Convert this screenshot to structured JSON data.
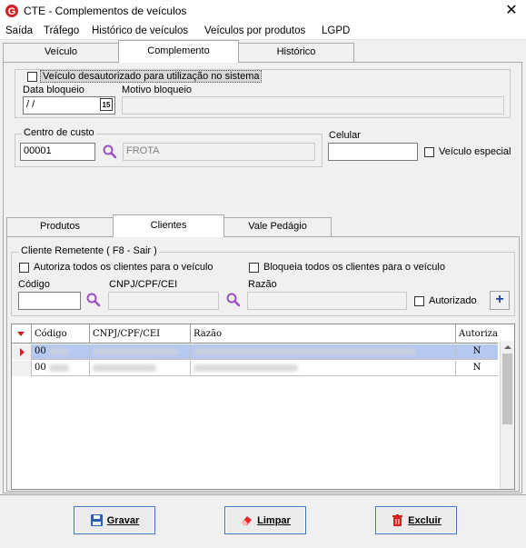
{
  "window": {
    "title": "CTE - Complementos de veículos",
    "close_glyph": "✕",
    "logo_letter": "G"
  },
  "menu": [
    "Saída",
    "Tráfego",
    "Histórico de veículos",
    "Veículos por produtos",
    "LGPD"
  ],
  "main_tabs": [
    {
      "label": "Veículo",
      "active": false
    },
    {
      "label": "Complemento",
      "active": true
    },
    {
      "label": "Histórico",
      "active": false
    }
  ],
  "vehicle_block": {
    "checkbox_label": "Veículo desautorizado para utilização no sistema",
    "checked": false,
    "data_bloqueio_label": "Data bloqueio",
    "data_bloqueio_value": " /  /",
    "calendar_glyph": "15",
    "motivo_label": "Motivo bloqueio",
    "motivo_value": ""
  },
  "centro_custo": {
    "group_label": "Centro de custo",
    "code_value": "00001",
    "name_value": "FROTA"
  },
  "celular": {
    "label": "Celular",
    "value": ""
  },
  "veiculo_especial": {
    "label": "Veículo especial",
    "checked": false
  },
  "sub_tabs": [
    {
      "label": "Produtos",
      "active": false
    },
    {
      "label": "Clientes",
      "active": true
    },
    {
      "label": "Vale Pedágio",
      "active": false
    }
  ],
  "cliente_remetente": {
    "group_label": "Cliente Remetente ( F8 - Sair )",
    "autoriza_todos": "Autoriza todos os clientes para o veículo",
    "bloqueia_todos": "Bloqueia todos os clientes para o veículo",
    "codigo_label": "Código",
    "cnpj_label": "CNPJ/CPF/CEI",
    "razao_label": "Razão",
    "autorizado_label": "Autorizado",
    "add_glyph": "+"
  },
  "grid": {
    "columns": [
      "Código",
      "CNPJ/CPF/CEI",
      "Razão",
      "Autoriza"
    ],
    "rows": [
      {
        "codigo": "00",
        "autoriza": "N",
        "selected": true
      },
      {
        "codigo": "00",
        "autoriza": "N",
        "selected": false
      }
    ]
  },
  "buttons": {
    "gravar": "Gravar",
    "limpar": "Limpar",
    "excluir": "Excluir"
  },
  "colors": {
    "accent": "#3b74c0",
    "selection": "#b4c8f0",
    "logo": "#d0202a",
    "search_icon": "#9b4fc0"
  }
}
